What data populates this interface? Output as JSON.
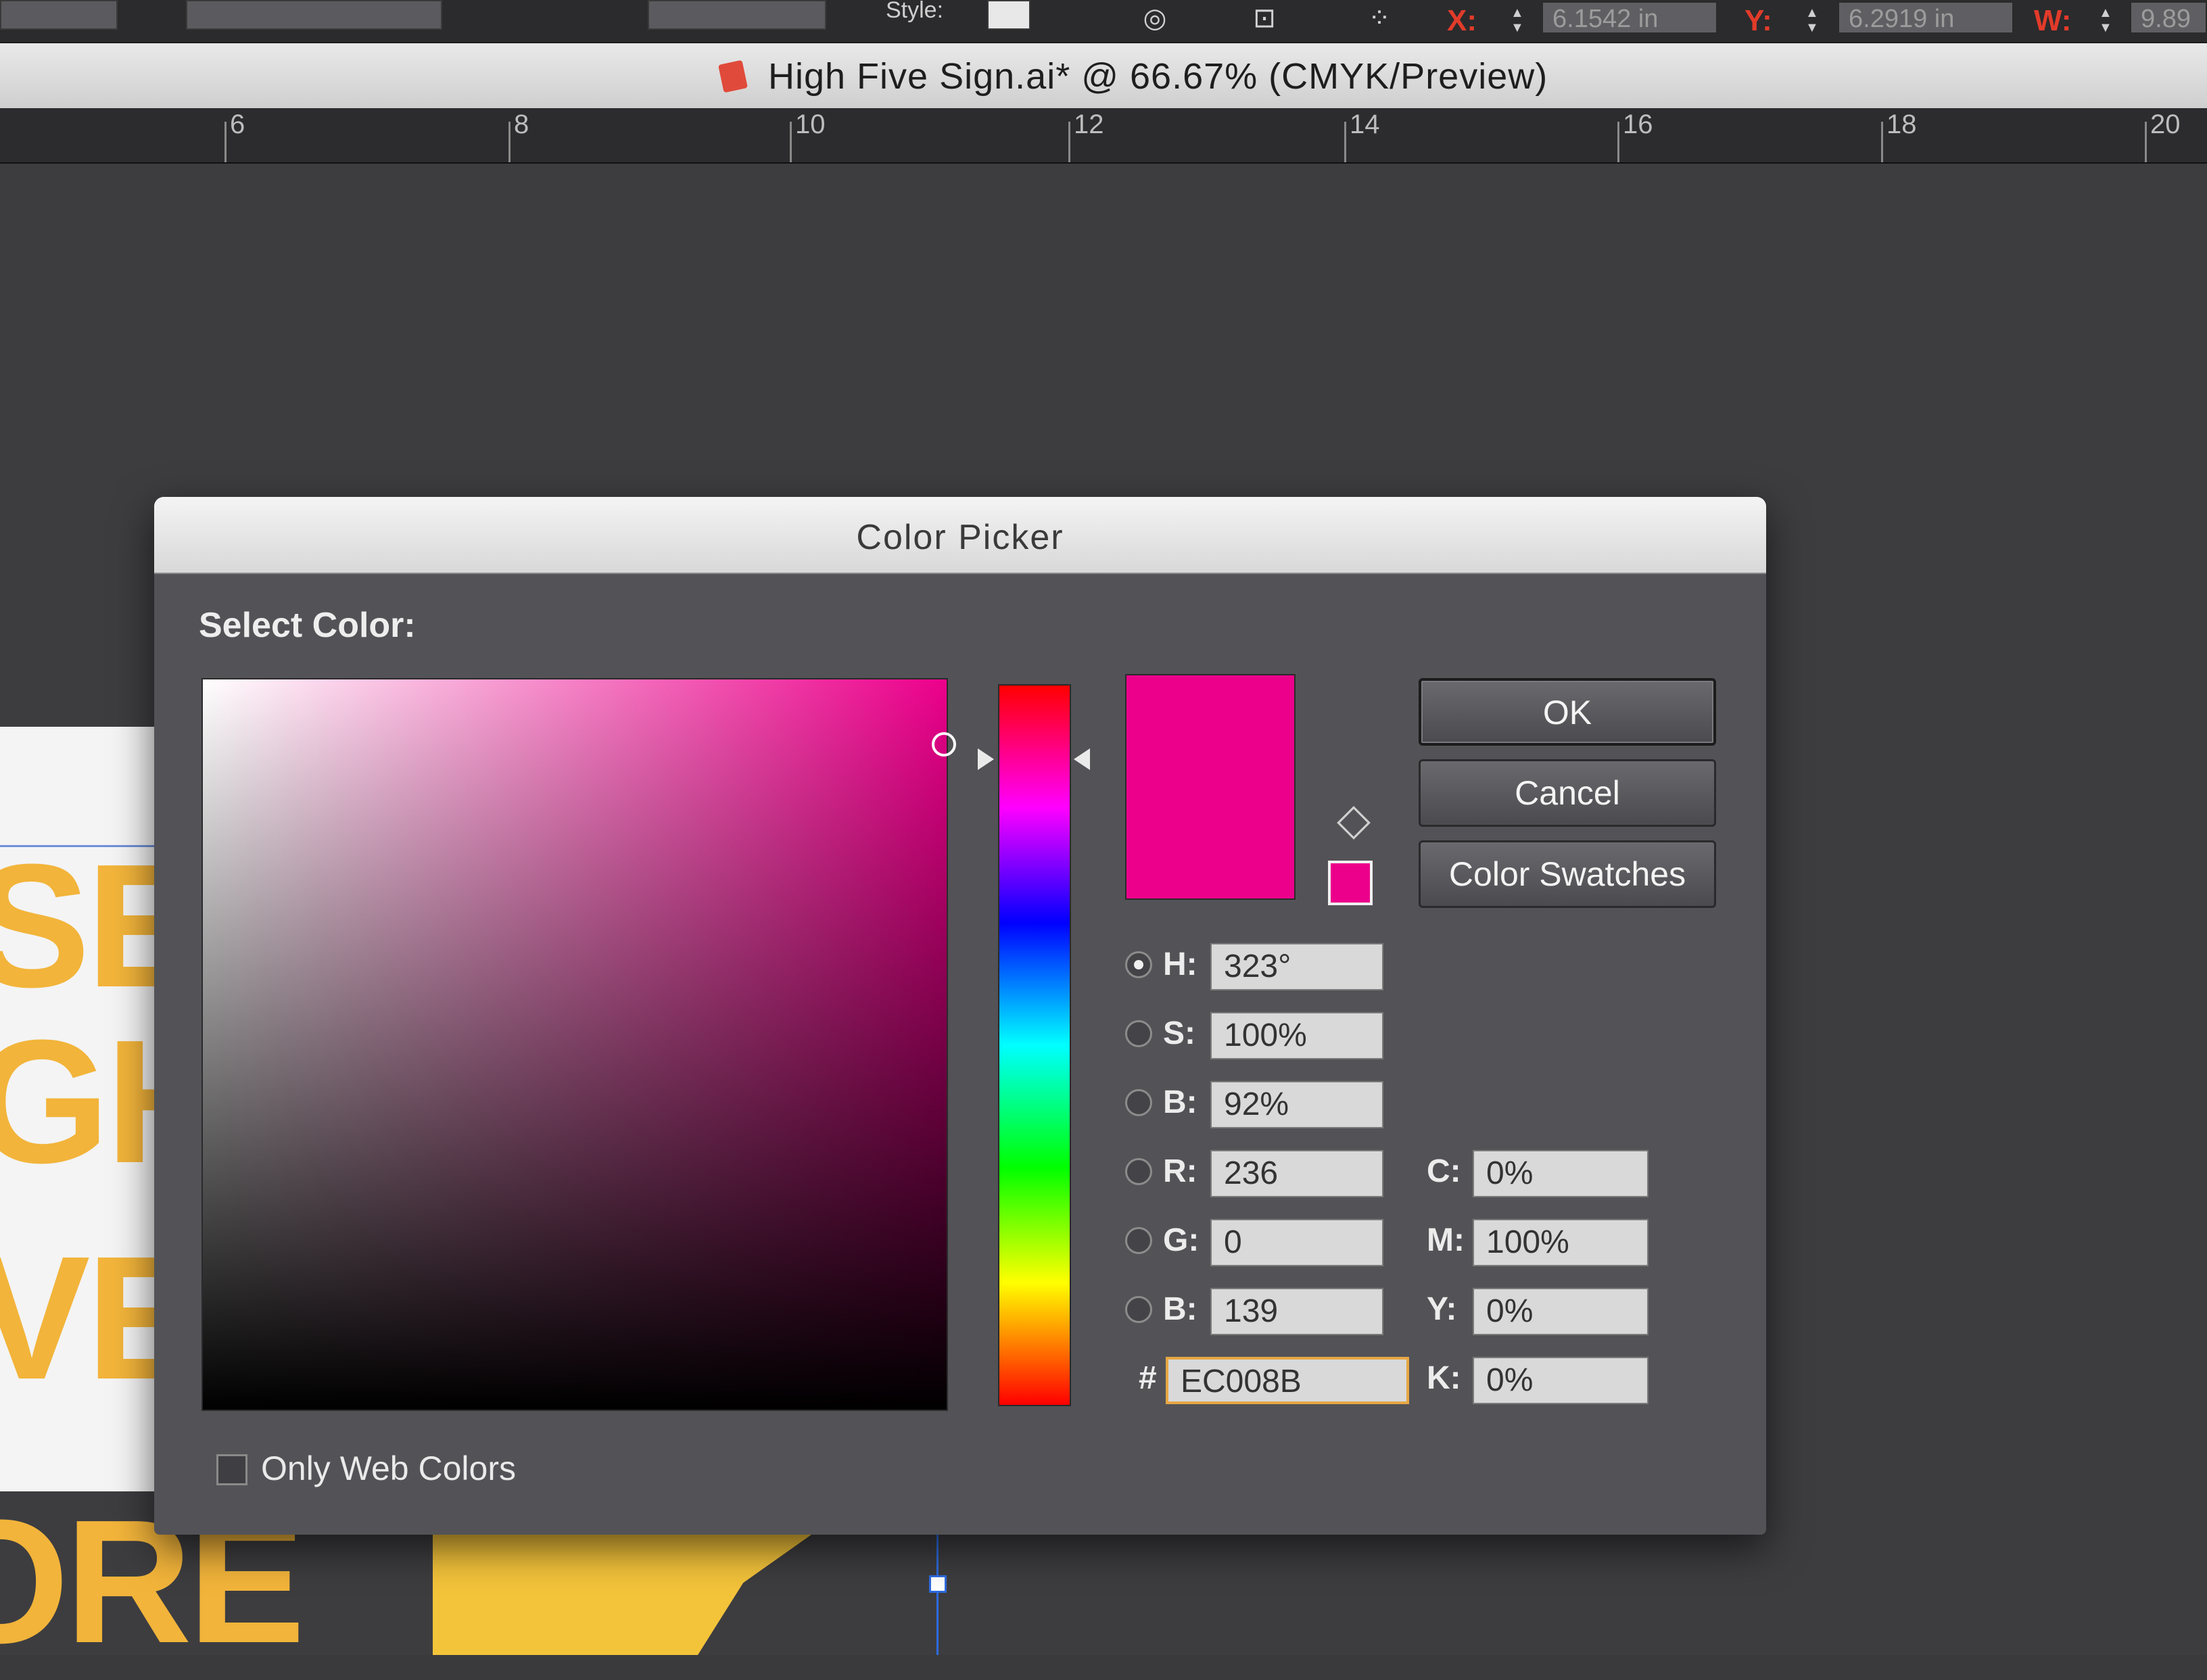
{
  "control_bar": {
    "style_label": "Style:",
    "x_label": "X:",
    "x_value": "6.1542 in",
    "y_label": "Y:",
    "y_value": "6.2919 in",
    "w_label": "W:",
    "w_value": "9.89"
  },
  "document": {
    "title": "High Five Sign.ai* @ 66.67% (CMYK/Preview)"
  },
  "ruler": {
    "labels": [
      "6",
      "8",
      "10",
      "12",
      "14",
      "16",
      "18",
      "20"
    ]
  },
  "artboard": {
    "letters": [
      "SE",
      "GH",
      "VE",
      "ORE"
    ],
    "letter_color": "#f2b43a"
  },
  "dialog": {
    "title": "Color Picker",
    "select_label": "Select Color:",
    "selected_color": "#ec008b",
    "hsb_mode": "H",
    "fields": {
      "H": {
        "label": "H:",
        "value": "323°"
      },
      "S": {
        "label": "S:",
        "value": "100%"
      },
      "B": {
        "label": "B:",
        "value": "92%"
      },
      "R": {
        "label": "R:",
        "value": "236"
      },
      "G": {
        "label": "G:",
        "value": "0"
      },
      "B2": {
        "label": "B:",
        "value": "139"
      },
      "hex": {
        "label": "#",
        "value": "EC008B"
      },
      "C": {
        "label": "C:",
        "value": "0%"
      },
      "M": {
        "label": "M:",
        "value": "100%"
      },
      "Y": {
        "label": "Y:",
        "value": "0%"
      },
      "K": {
        "label": "K:",
        "value": "0%"
      }
    },
    "buttons": {
      "ok": "OK",
      "cancel": "Cancel",
      "swatches": "Color Swatches"
    },
    "web_colors_label": "Only Web Colors",
    "web_colors_checked": false
  }
}
